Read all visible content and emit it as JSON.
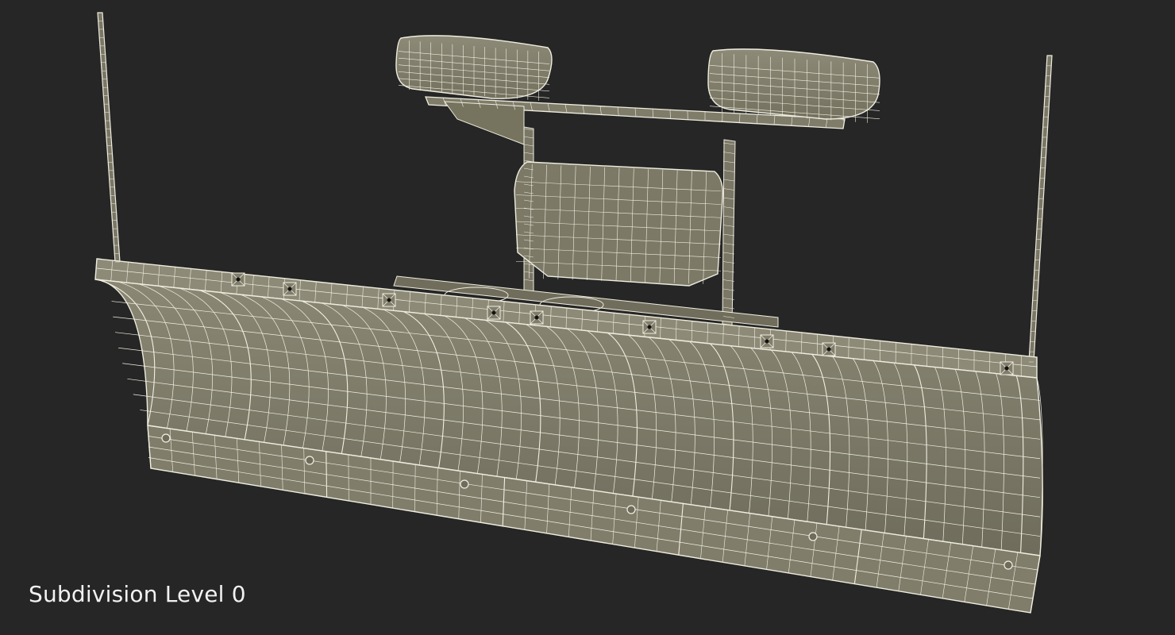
{
  "viewport": {
    "caption": "Subdivision Level 0",
    "background": "#262626"
  },
  "model": {
    "subject": "snow-plow-blade",
    "render_style": "wireframe-over-clay",
    "surface_color": "#7d7a68",
    "wire_color": "#f2f0e2"
  }
}
